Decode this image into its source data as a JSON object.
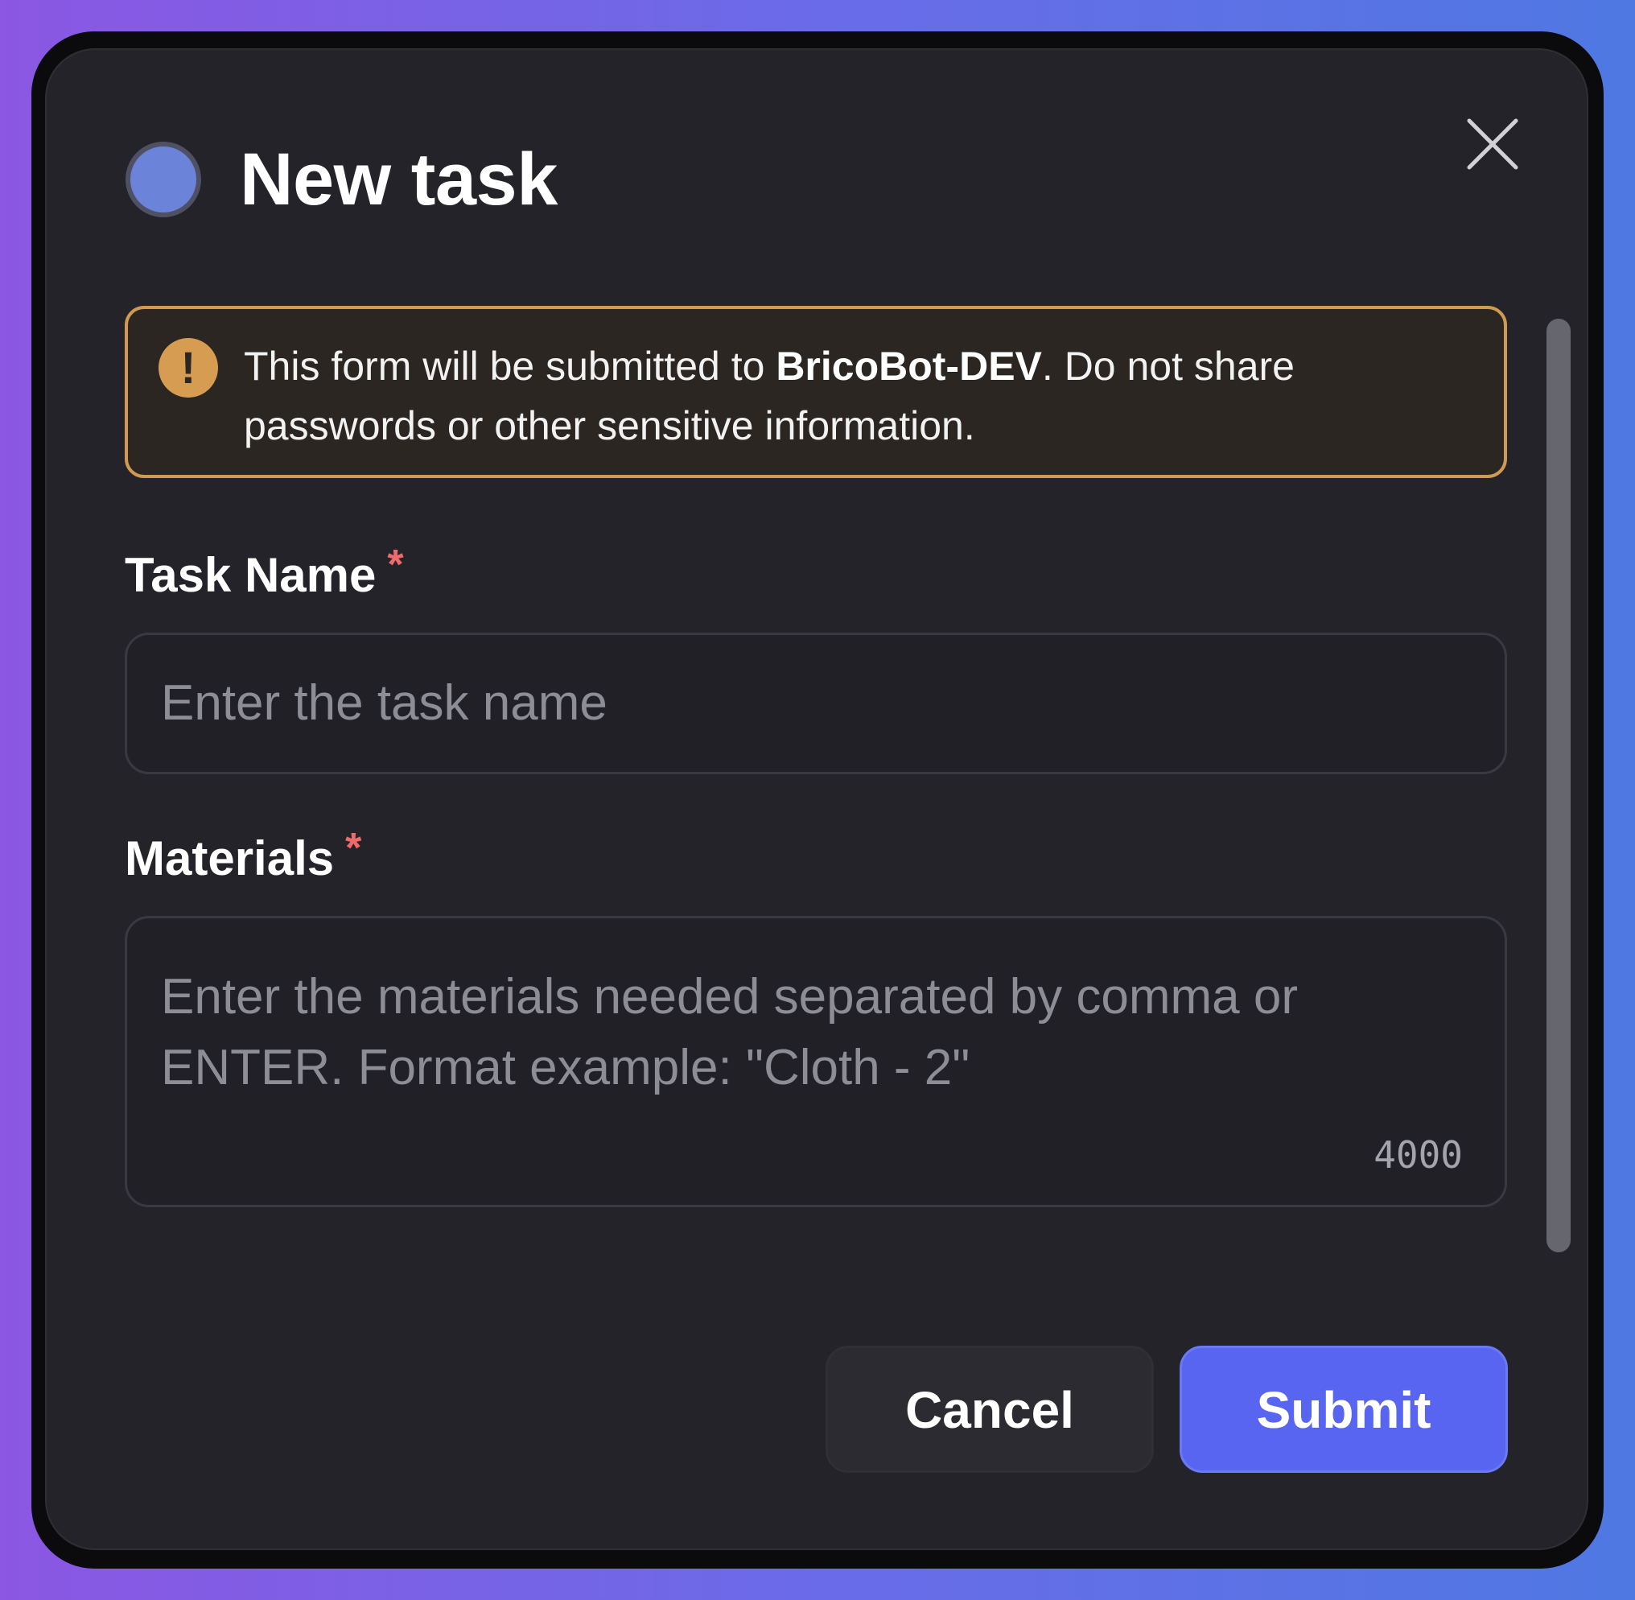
{
  "dialog": {
    "title": "New task",
    "app_dot_color": "#6b83d8",
    "close_icon": "close-icon"
  },
  "warning": {
    "icon": "exclamation-icon",
    "text_before": "This form will be submitted to ",
    "bot_name": "BricoBot-DEV",
    "text_after": ". Do not share passwords or other sensitive information.",
    "border_color": "#d19a52"
  },
  "task_name": {
    "label": "Task Name",
    "required_mark": "*",
    "placeholder": "Enter the task name",
    "value": ""
  },
  "materials": {
    "label": "Materials",
    "required_mark": "*",
    "placeholder": "Enter the materials needed separated by comma or ENTER. Format example: \"Cloth - 2\"",
    "value": "",
    "char_limit": "4000"
  },
  "actions": {
    "cancel_label": "Cancel",
    "submit_label": "Submit",
    "submit_color": "#5765f0"
  }
}
